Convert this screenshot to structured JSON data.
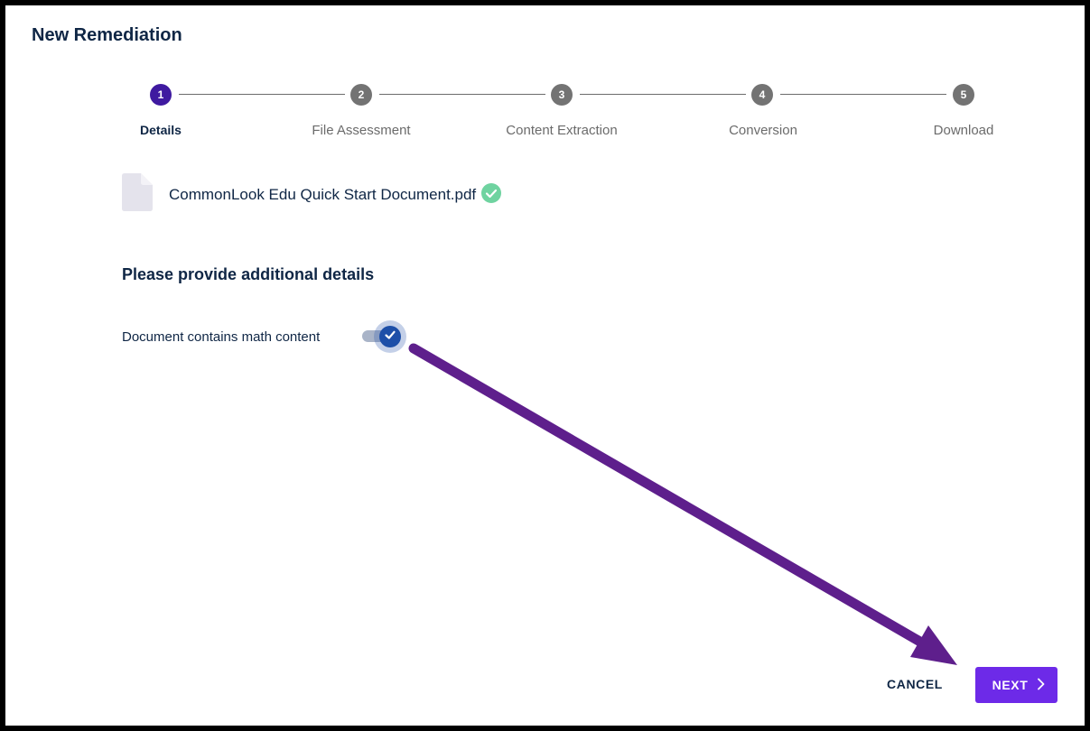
{
  "dialog": {
    "title": "New Remediation"
  },
  "stepper": {
    "steps": [
      {
        "number": "1",
        "label": "Details",
        "active": true
      },
      {
        "number": "2",
        "label": "File Assessment",
        "active": false
      },
      {
        "number": "3",
        "label": "Content Extraction",
        "active": false
      },
      {
        "number": "4",
        "label": "Conversion",
        "active": false
      },
      {
        "number": "5",
        "label": "Download",
        "active": false
      }
    ]
  },
  "file": {
    "name": "CommonLook Edu Quick Start Document.pdf",
    "icon": "document-icon",
    "status_icon": "check-circle-icon"
  },
  "details": {
    "heading": "Please provide additional details",
    "math_toggle_label": "Document contains math content",
    "math_toggle_checked": true
  },
  "footer": {
    "cancel_label": "CANCEL",
    "next_label": "NEXT"
  },
  "colors": {
    "accent": "#6d2ae8",
    "active_step": "#3f1aa0",
    "inactive_step": "#737373",
    "heading_text": "#0f2645",
    "success": "#6fd3a0",
    "toggle_on": "#1d4fa8",
    "annotation_arrow": "#5e1f8c"
  }
}
